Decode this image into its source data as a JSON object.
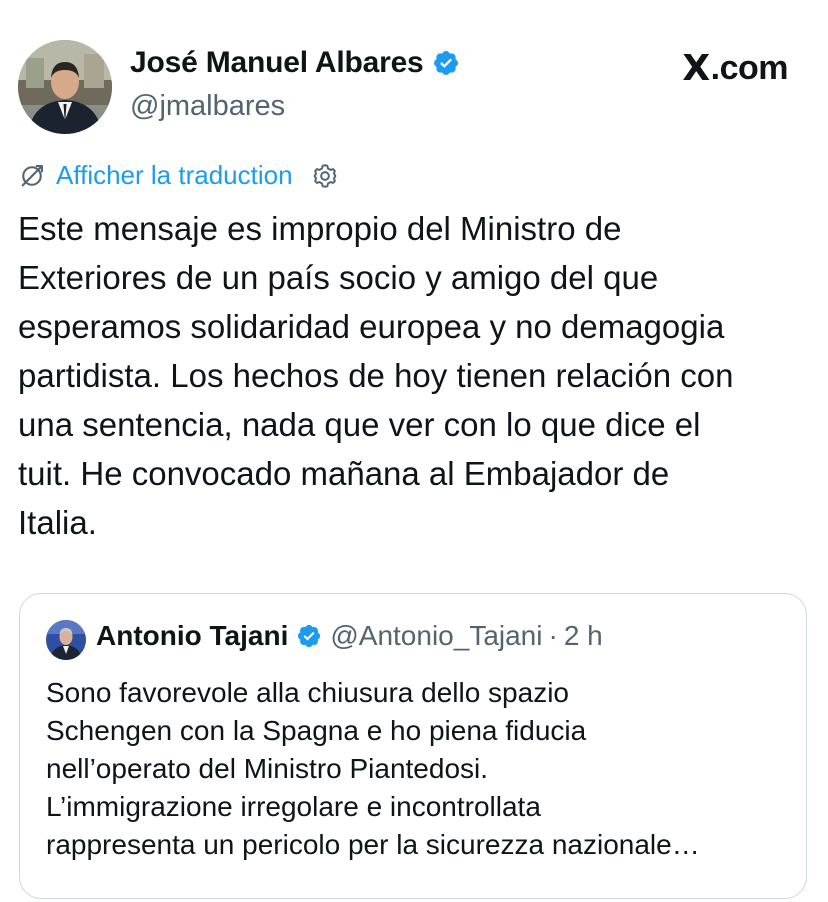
{
  "tweet": {
    "author_name": "José Manuel Albares",
    "author_handle": "@jmalbares",
    "translate_link": "Afficher la traduction",
    "text": "Este mensaje es impropio del Ministro de\nExteriores de un país socio y amigo del que\nesperamos solidaridad europea y no demagogia\npartidista. Los hechos de hoy tienen relación con\nuna sentencia, nada que ver con lo que dice el\ntuit. He convocado mañana al Embajador de\nItalia."
  },
  "brand": {
    "glyph": "X",
    "suffix": ".com"
  },
  "quoted_tweet": {
    "author_name": "Antonio Tajani",
    "author_handle": "@Antonio_Tajani",
    "separator": "·",
    "time": "2 h",
    "text": "Sono favorevole alla chiusura dello spazio\nSchengen con la Spagna e ho piena fiducia\nnell’operato del Ministro Piantedosi.\nL’immigrazione irregolare e incontrollata\nrappresenta un pericolo per la sicurezza nazionale…"
  },
  "icons": {
    "verified": "verified-badge-icon",
    "translate": "translate-icon",
    "settings": "gear-icon"
  },
  "colors": {
    "link": "#1d9bf0",
    "verified": "#1d9bf0",
    "secondary_text": "#536471",
    "border": "#cfd9de"
  }
}
